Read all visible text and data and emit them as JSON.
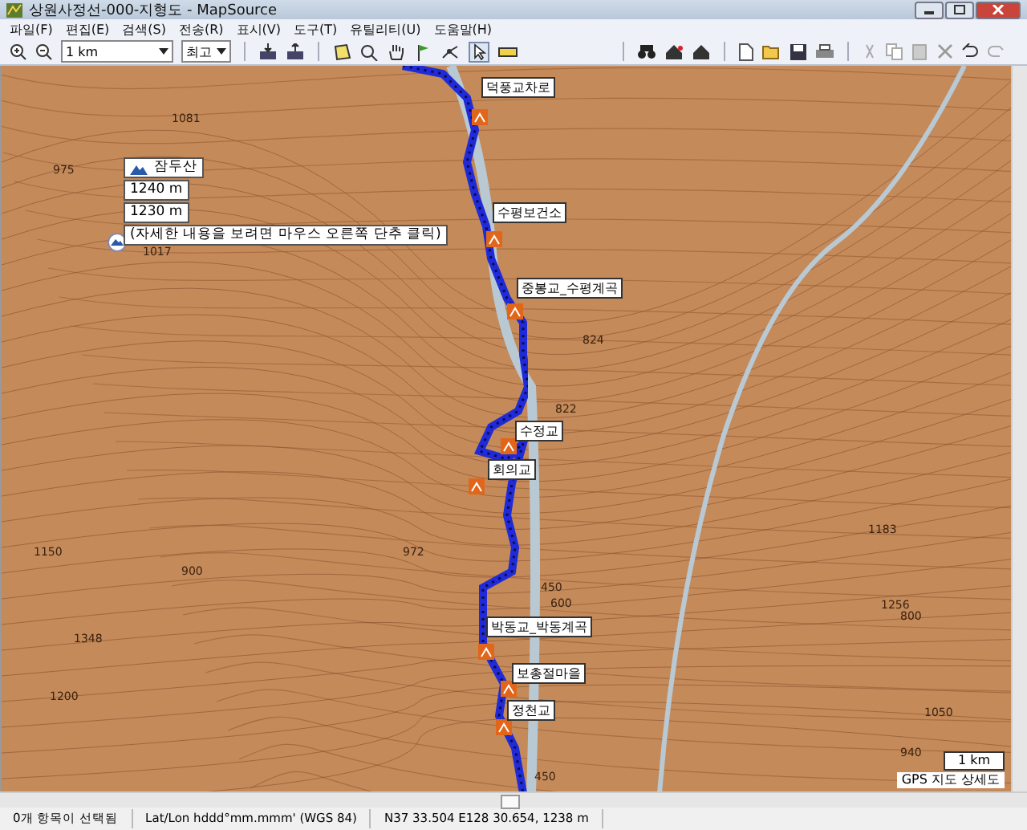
{
  "window": {
    "title": "상원사정선-000-지형도 - MapSource"
  },
  "menu": [
    "파일(F)",
    "편집(E)",
    "검색(S)",
    "전송(R)",
    "표시(V)",
    "도구(T)",
    "유틸리티(U)",
    "도움말(H)"
  ],
  "toolbar": {
    "zoom_scale": "1 km",
    "detail": "최고"
  },
  "map": {
    "waypoints": [
      {
        "name": "덕풍교차로"
      },
      {
        "name": "수평보건소"
      },
      {
        "name": "중봉교_수평계곡"
      },
      {
        "name": "수정교"
      },
      {
        "name": "회의교"
      },
      {
        "name": "박동교_박동계곡"
      },
      {
        "name": "보총절마을"
      },
      {
        "name": "정천교"
      }
    ],
    "contour_labels": [
      "975",
      "1081",
      "1017",
      "824",
      "822",
      "600",
      "450",
      "800",
      "1150",
      "1200",
      "972",
      "900",
      "1348",
      "1183",
      "1256",
      "1050",
      "940",
      "450"
    ],
    "tooltip": {
      "name": "잠두산",
      "lines": [
        "1240 m",
        "1230 m",
        "(자세한 내용을 보려면 마우스 오른쪽 단추 클릭)"
      ]
    },
    "scale": "1 km",
    "map_name": "GPS 지도 상세도"
  },
  "status_bar": [
    "0개 항목이 선택됨",
    "Lat/Lon hddd°mm.mmm' (WGS 84)",
    "N37 33.504 E128 30.654, 1238 m"
  ]
}
